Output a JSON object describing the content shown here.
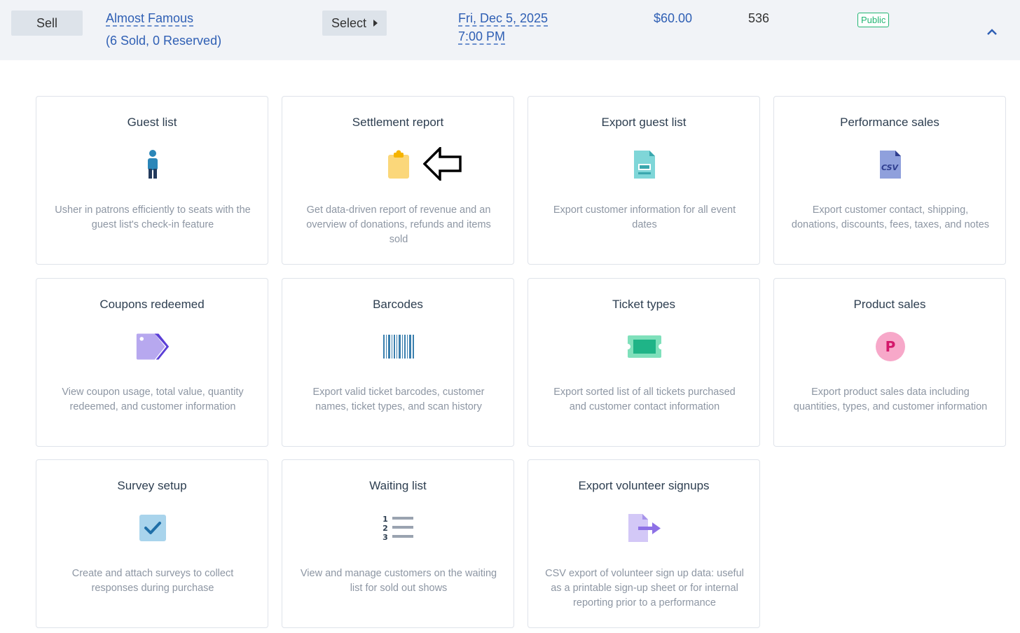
{
  "header": {
    "sell_label": "Sell",
    "event_title": "Almost Famous",
    "event_sub": "(6 Sold, 0 Reserved)",
    "select_label": "Select",
    "date": "Fri, Dec 5, 2025",
    "time": "7:00 PM",
    "price": "$60.00",
    "count": "536",
    "visibility": "Public"
  },
  "cards": [
    {
      "title": "Guest list",
      "icon": "person-icon",
      "desc": "Usher in patrons efficiently to seats with the guest list's check-in feature"
    },
    {
      "title": "Settlement report",
      "icon": "clipboard-icon",
      "desc": "Get data-driven report of revenue and an overview of donations, refunds and items sold"
    },
    {
      "title": "Export guest list",
      "icon": "document-export-icon",
      "desc": "Export customer information for all event dates"
    },
    {
      "title": "Performance sales",
      "icon": "csv-file-icon",
      "desc": "Export customer contact, shipping, donations, discounts, fees, taxes, and notes"
    },
    {
      "title": "Coupons redeemed",
      "icon": "tags-icon",
      "desc": "View coupon usage, total value, quantity redeemed, and customer information"
    },
    {
      "title": "Barcodes",
      "icon": "barcode-icon",
      "desc": "Export valid ticket barcodes, customer names, ticket types, and scan history"
    },
    {
      "title": "Ticket types",
      "icon": "ticket-icon",
      "desc": "Export sorted list of all tickets purchased and customer contact information"
    },
    {
      "title": "Product sales",
      "icon": "product-p-icon",
      "desc": "Export product sales data including quantities, types, and customer information"
    },
    {
      "title": "Survey setup",
      "icon": "checkbox-icon",
      "desc": "Create and attach surveys to collect responses during purchase"
    },
    {
      "title": "Waiting list",
      "icon": "numbered-list-icon",
      "desc": "View and manage customers on the waiting list for sold out shows"
    },
    {
      "title": "Export volunteer signups",
      "icon": "file-export-arrow-icon",
      "desc": "CSV export of volunteer sign up data: useful as a printable sign-up sheet or for internal reporting prior to a performance"
    }
  ],
  "colors": {
    "link": "#2f5fb4",
    "badge_green": "#22b573",
    "header_bg": "#f1f3f7",
    "desc_gray": "#8d96a3"
  }
}
